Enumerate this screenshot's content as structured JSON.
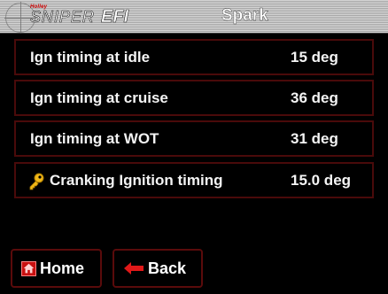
{
  "header": {
    "brand_small": "Holley",
    "brand_sniper": "SNIPER",
    "brand_efi": "EFI",
    "title": "Spark"
  },
  "rows": [
    {
      "label": "Ign timing at idle",
      "value": "15 deg"
    },
    {
      "label": "Ign timing at cruise",
      "value": "36 deg"
    },
    {
      "label": "Ign timing at WOT",
      "value": "31 deg"
    },
    {
      "label": "Cranking Ignition timing",
      "value": "15.0 deg",
      "icon": "key-icon"
    }
  ],
  "buttons": {
    "home_label": "Home",
    "home_icon": "home-icon",
    "back_label": "Back",
    "back_icon": "left-arrow-icon"
  },
  "colors": {
    "row_border": "#4a0a0a",
    "button_border": "#5a0b0b",
    "accent_red": "#c81010",
    "key_gold": "#f2b818"
  }
}
